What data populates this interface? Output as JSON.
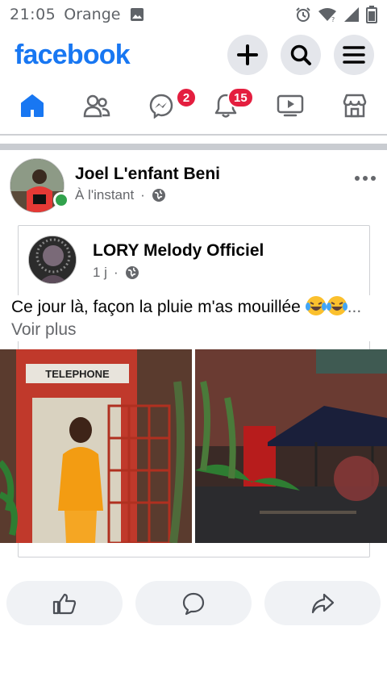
{
  "status_bar": {
    "time": "21:05",
    "carrier": "Orange"
  },
  "header": {
    "brand": "facebook",
    "brand_color": "#1877f2"
  },
  "tabs": [
    {
      "name": "home",
      "icon": "home-icon",
      "active": true,
      "badge": ""
    },
    {
      "name": "friends",
      "icon": "friends-icon",
      "active": false,
      "badge": ""
    },
    {
      "name": "messenger",
      "icon": "messenger-icon",
      "active": false,
      "badge": "2"
    },
    {
      "name": "notifications",
      "icon": "bell-icon",
      "active": false,
      "badge": "15"
    },
    {
      "name": "watch",
      "icon": "video-icon",
      "active": false,
      "badge": ""
    },
    {
      "name": "marketplace",
      "icon": "marketplace-icon",
      "active": false,
      "badge": ""
    }
  ],
  "post": {
    "author": "Joel L'enfant Beni",
    "time": "À l'instant",
    "separator": "·",
    "shared": {
      "author": "LORY Melody Officiel",
      "time": "1 j",
      "separator": "·"
    },
    "caption": "Ce jour là, façon la pluie m'as mouillée ",
    "see_more_prefix": "... ",
    "see_more": "Voir plus",
    "emoji": "face-with-tears-of-joy"
  },
  "actions": [
    {
      "name": "like",
      "icon": "thumbs-up-icon"
    },
    {
      "name": "comment",
      "icon": "comment-icon"
    },
    {
      "name": "share",
      "icon": "share-icon"
    }
  ],
  "colors": {
    "badge": "#e41e3f",
    "online": "#31a24c",
    "accent": "#1877f2"
  }
}
